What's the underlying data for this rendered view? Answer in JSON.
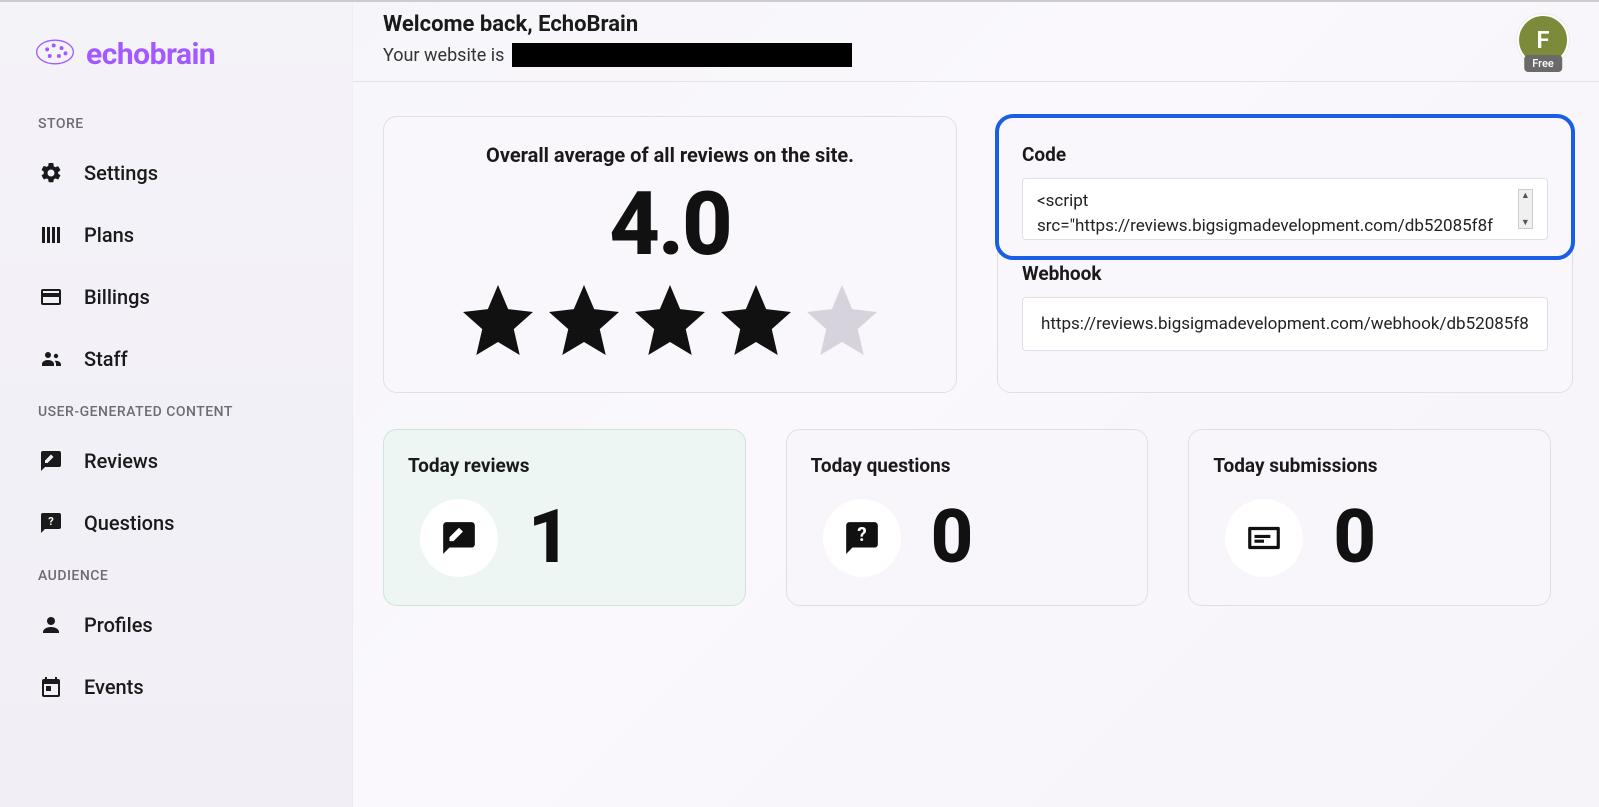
{
  "brand": {
    "name": "echobrain"
  },
  "sidebar": {
    "sections": [
      {
        "title": "STORE",
        "items": [
          {
            "label": "Settings",
            "icon": "gear-icon"
          },
          {
            "label": "Plans",
            "icon": "plans-icon"
          },
          {
            "label": "Billings",
            "icon": "card-icon"
          },
          {
            "label": "Staff",
            "icon": "staff-icon"
          }
        ]
      },
      {
        "title": "USER-GENERATED CONTENT",
        "items": [
          {
            "label": "Reviews",
            "icon": "review-icon"
          },
          {
            "label": "Questions",
            "icon": "question-icon"
          }
        ]
      },
      {
        "title": "AUDIENCE",
        "items": [
          {
            "label": "Profiles",
            "icon": "person-icon"
          },
          {
            "label": "Events",
            "icon": "calendar-icon"
          }
        ]
      }
    ]
  },
  "header": {
    "welcome": "Welcome back, EchoBrain",
    "website_prefix": "Your website is",
    "avatar_initial": "F",
    "avatar_badge": "Free"
  },
  "overall": {
    "title": "Overall average of all reviews on the site.",
    "value": "4.0",
    "stars_filled": 4,
    "stars_total": 5
  },
  "code": {
    "label": "Code",
    "value": "<script src=\"https://reviews.bigsigmadevelopment.com/db52085f8f"
  },
  "webhook": {
    "label": "Webhook",
    "value": "https://reviews.bigsigmadevelopment.com/webhook/db52085f8"
  },
  "stats": [
    {
      "title": "Today reviews",
      "value": "1",
      "icon": "rate-review-icon",
      "highlight": true
    },
    {
      "title": "Today questions",
      "value": "0",
      "icon": "question-bubble-icon",
      "highlight": false
    },
    {
      "title": "Today submissions",
      "value": "0",
      "icon": "submission-icon",
      "highlight": false
    }
  ]
}
